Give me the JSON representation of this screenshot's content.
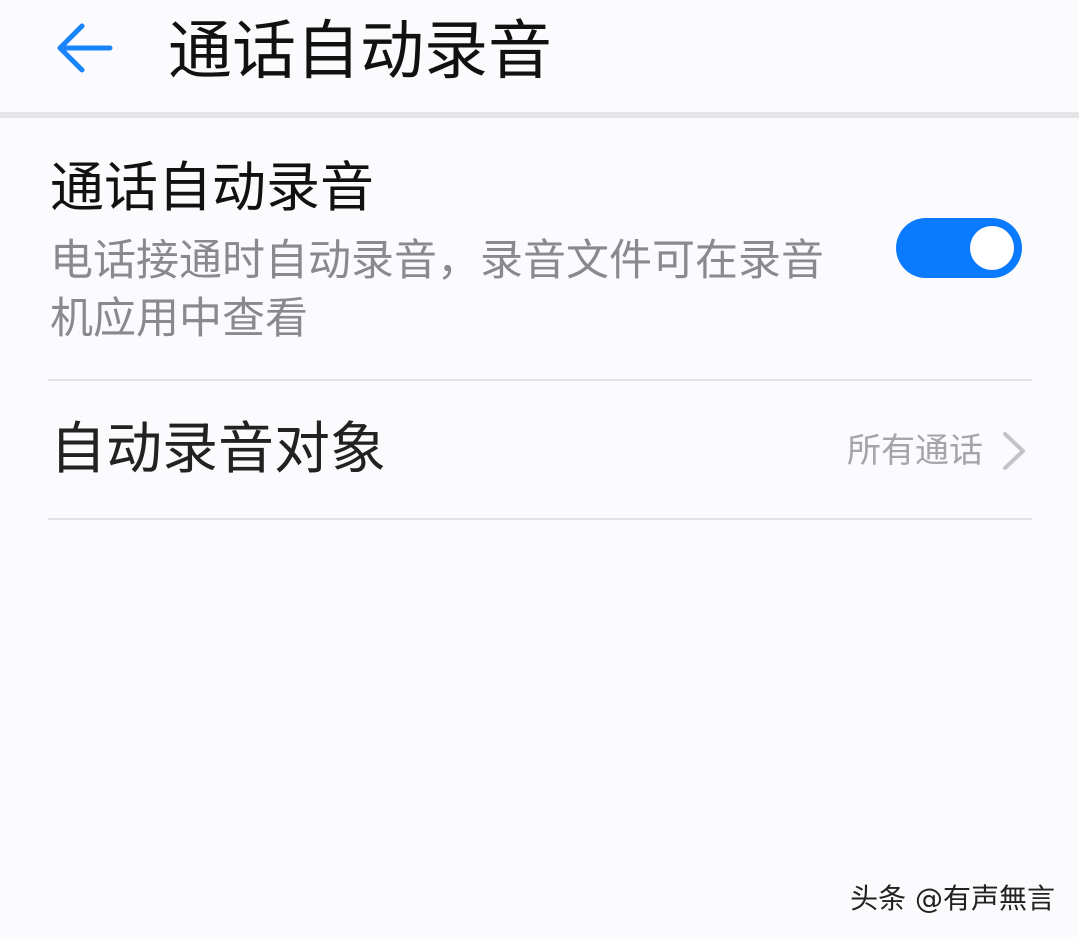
{
  "header": {
    "back_icon": "arrow-left-icon",
    "title": "通话自动录音",
    "accent_color": "#0a7bff"
  },
  "settings": {
    "auto_record": {
      "title": "通话自动录音",
      "description": "电话接通时自动录音，录音文件可在录音机应用中查看",
      "enabled": true
    },
    "record_target": {
      "label": "自动录音对象",
      "value": "所有通话",
      "chevron_icon": "chevron-right-icon"
    }
  },
  "watermark": "头条 @有声無言"
}
